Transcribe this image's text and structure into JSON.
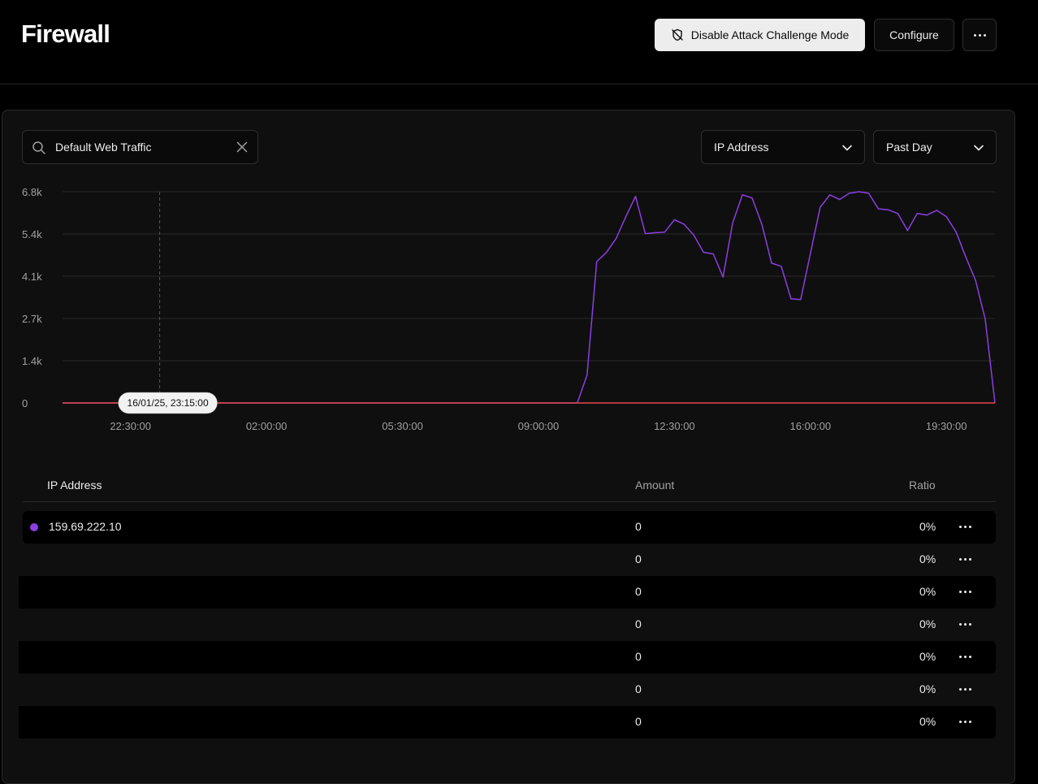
{
  "header": {
    "title": "Firewall",
    "disable_button": "Disable Attack Challenge Mode",
    "configure_button": "Configure",
    "more_icon": "ellipsis-icon"
  },
  "filters": {
    "search_value": "Default Web Traffic",
    "group_by": "IP Address",
    "time_range": "Past Day"
  },
  "colors": {
    "accent": "#8b3fe0",
    "baseline": "#e5484d",
    "row_dot": "#8b3fe0"
  },
  "chart_data": {
    "type": "line",
    "ylim": [
      0,
      6800
    ],
    "y_ticks": [
      "0",
      "1.4k",
      "2.7k",
      "4.1k",
      "5.4k",
      "6.8k"
    ],
    "x_ticks": [
      "22:30:00",
      "02:00:00",
      "05:30:00",
      "09:00:00",
      "12:30:00",
      "16:00:00",
      "19:30:00"
    ],
    "x_tick_hours": [
      22.5,
      26,
      29.5,
      33,
      36.5,
      40,
      43.5
    ],
    "hover_label": "16/01/25, 23:15:00",
    "hover_hour": 23.25,
    "grid": true,
    "series": [
      {
        "color": "#8b3fe0",
        "points": [
          [
            20.75,
            0
          ],
          [
            34.0,
            0
          ],
          [
            34.25,
            900
          ],
          [
            34.5,
            4550
          ],
          [
            34.75,
            4850
          ],
          [
            35.0,
            5300
          ],
          [
            35.25,
            6000
          ],
          [
            35.5,
            6650
          ],
          [
            35.75,
            5450
          ],
          [
            36.0,
            5480
          ],
          [
            36.25,
            5500
          ],
          [
            36.5,
            5900
          ],
          [
            36.75,
            5750
          ],
          [
            37.0,
            5400
          ],
          [
            37.25,
            4850
          ],
          [
            37.5,
            4800
          ],
          [
            37.75,
            4050
          ],
          [
            38.0,
            5800
          ],
          [
            38.25,
            6700
          ],
          [
            38.5,
            6600
          ],
          [
            38.75,
            5750
          ],
          [
            39.0,
            4500
          ],
          [
            39.25,
            4400
          ],
          [
            39.5,
            3350
          ],
          [
            39.75,
            3330
          ],
          [
            40.25,
            6300
          ],
          [
            40.5,
            6700
          ],
          [
            40.75,
            6550
          ],
          [
            41.0,
            6750
          ],
          [
            41.25,
            6800
          ],
          [
            41.5,
            6750
          ],
          [
            41.75,
            6250
          ],
          [
            42.0,
            6220
          ],
          [
            42.25,
            6100
          ],
          [
            42.5,
            5550
          ],
          [
            42.75,
            6100
          ],
          [
            43.0,
            6050
          ],
          [
            43.25,
            6200
          ],
          [
            43.5,
            6000
          ],
          [
            43.75,
            5500
          ],
          [
            44.0,
            4700
          ],
          [
            44.25,
            3950
          ],
          [
            44.5,
            2700
          ],
          [
            44.75,
            0
          ]
        ]
      },
      {
        "color": "#e5484d",
        "points": [
          [
            20.75,
            0
          ],
          [
            44.75,
            0
          ]
        ]
      }
    ]
  },
  "table": {
    "columns": {
      "ip": "IP Address",
      "amount": "Amount",
      "ratio": "Ratio"
    },
    "rows": [
      {
        "ip": "159.69.222.10",
        "amount": "0",
        "ratio": "0%",
        "dot": true
      },
      {
        "ip": "",
        "amount": "0",
        "ratio": "0%",
        "dot": false
      },
      {
        "ip": "",
        "amount": "0",
        "ratio": "0%",
        "dot": false
      },
      {
        "ip": "",
        "amount": "0",
        "ratio": "0%",
        "dot": false
      },
      {
        "ip": "",
        "amount": "0",
        "ratio": "0%",
        "dot": false
      },
      {
        "ip": "",
        "amount": "0",
        "ratio": "0%",
        "dot": false
      },
      {
        "ip": "",
        "amount": "0",
        "ratio": "0%",
        "dot": false
      }
    ]
  }
}
